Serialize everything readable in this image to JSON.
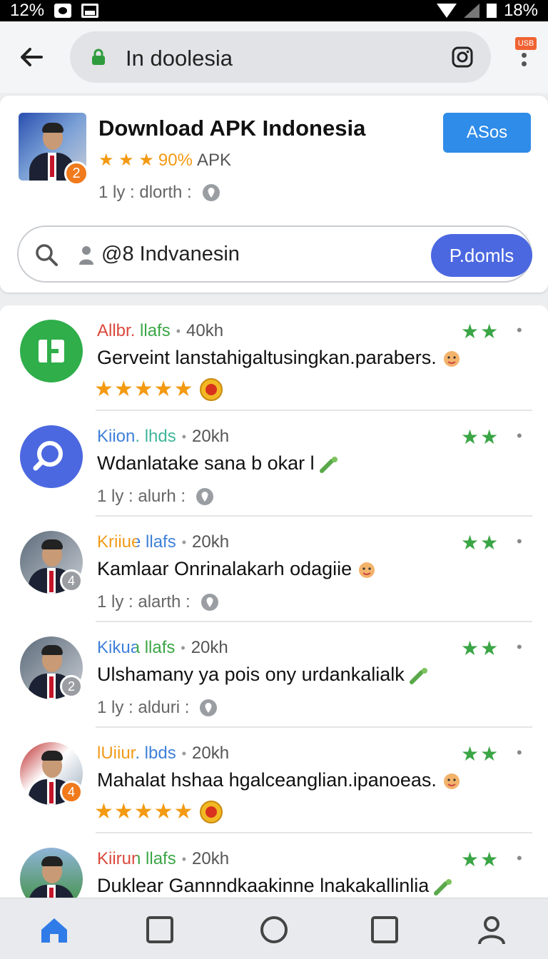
{
  "status_bar": {
    "time": "12%",
    "battery": "18%"
  },
  "browser": {
    "url": "In doolesia",
    "menu_badge": "USB"
  },
  "app": {
    "title": "Download APK Indonesia",
    "badge_count": "2",
    "stars": "★ ★ ★",
    "rating": "90%",
    "rating_suffix": "APK",
    "meta": "1 ly : dlorth :",
    "install_label": "ASos"
  },
  "search": {
    "value": "@8 Indvanesin",
    "button_label": "P.domls"
  },
  "feed": {
    "items": [
      {
        "name": "Allbr. llafs",
        "name_color": "#d9473a",
        "name_color2": "#3aa545",
        "count": "40kh",
        "message": "Gerveint lanstahigaltusingkan.parabers.",
        "meta": "",
        "stars": "★★★★★",
        "avatar_type": "green-logo",
        "avatar_num": ""
      },
      {
        "name": "Kiion. lhds",
        "name_color": "#3d7fd9",
        "name_color2": "#3db59b",
        "count": "20kh",
        "message": "Wdanlatake sana b okar l",
        "meta": "1 ly : alurh :",
        "stars": "",
        "avatar_type": "blue-search",
        "avatar_num": ""
      },
      {
        "name": "Kriiue llafs",
        "name_color": "#ef9a16",
        "name_color2": "#3d7fd9",
        "count": "20kh",
        "message": "Kamlaar Onrinalakarh odagiie",
        "meta": "1 ly : alarth :",
        "stars": "",
        "avatar_type": "person",
        "avatar_num": "4"
      },
      {
        "name": "Kikua llafs",
        "name_color": "#3d7fd9",
        "name_color2": "#3aa545",
        "count": "20kh",
        "message": "Ulshamany ya pois ony urdankalialk",
        "meta": "1 ly : alduri :",
        "stars": "",
        "avatar_type": "person",
        "avatar_num": "2"
      },
      {
        "name": "lUiiur. lbds",
        "name_color": "#ef9a16",
        "name_color2": "#3d7fd9",
        "count": "20kh",
        "message": "Mahalat hshaa hgalceanglian.ipanoeas.",
        "meta": "",
        "stars": "★★★★★",
        "avatar_type": "person",
        "avatar_num": "4"
      },
      {
        "name": "Kiirun llafs",
        "name_color": "#d9473a",
        "name_color2": "#3aa545",
        "count": "20kh",
        "message": "Duklear Gannndkaakinne lnakakallinlia",
        "meta": "",
        "stars": "",
        "avatar_type": "person",
        "avatar_num": ""
      }
    ]
  },
  "bottom_nav": [
    "home-icon",
    "square-icon",
    "circle-icon",
    "square-icon",
    "profile-icon"
  ],
  "colors": {
    "accent_blue": "#2f8ce8",
    "search_blue": "#4b68e0",
    "star_orange": "#f39a12",
    "star_green": "#3aa545"
  }
}
